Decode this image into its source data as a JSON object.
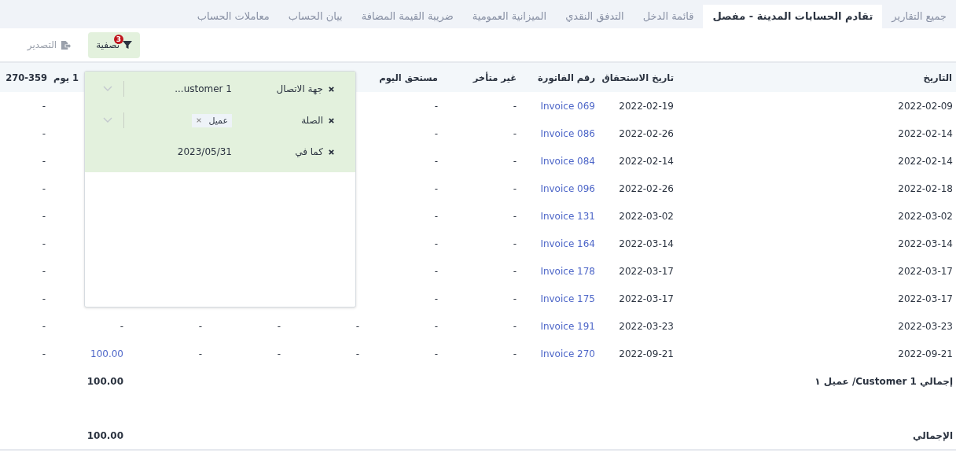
{
  "tabs": [
    {
      "label": "جميع التقارير",
      "selected": false
    },
    {
      "label": "تقادم الحسابات المدينة - مفصل",
      "selected": true
    },
    {
      "label": "قائمة الدخل",
      "selected": false
    },
    {
      "label": "التدفق النقدي",
      "selected": false
    },
    {
      "label": "الميزانية العمومية",
      "selected": false
    },
    {
      "label": "ضريبة القيمة المضافة",
      "selected": false
    },
    {
      "label": "بيان الحساب",
      "selected": false
    },
    {
      "label": "معاملات الحساب",
      "selected": false
    }
  ],
  "toolbar": {
    "filter_button": {
      "label": "تصفية",
      "badge": "3"
    },
    "export_button": {
      "label": "التصدير",
      "disabled": true
    }
  },
  "filter_panel": {
    "filters": [
      {
        "kind": "select",
        "label": "جهة الاتصال",
        "value": "...ustomer 1"
      },
      {
        "kind": "tags",
        "label": "الصلة",
        "tags": [
          "عميل"
        ]
      },
      {
        "kind": "date",
        "label": "كما في",
        "value": "2023/05/31"
      }
    ]
  },
  "table": {
    "columns": [
      "التاريخ",
      "تاريخ الاستحقاق",
      "رقم الفاتورة",
      "غير متأخر",
      "مستحق اليوم",
      null,
      null,
      null,
      "1 يوم",
      "270-359"
    ],
    "rows": [
      {
        "cells": [
          "2022-02-09",
          "2022-02-19",
          {
            "text": "Invoice 069",
            "link": true
          },
          "-",
          "-",
          null,
          null,
          null,
          null,
          "-"
        ]
      },
      {
        "cells": [
          "2022-02-14",
          "2022-02-26",
          {
            "text": "Invoice 086",
            "link": true
          },
          "-",
          "-",
          null,
          null,
          null,
          null,
          "-"
        ]
      },
      {
        "cells": [
          "2022-02-14",
          "2022-02-14",
          {
            "text": "Invoice 084",
            "link": true
          },
          "-",
          "-",
          null,
          null,
          null,
          null,
          "-"
        ]
      },
      {
        "cells": [
          "2022-02-18",
          "2022-02-26",
          {
            "text": "Invoice 096",
            "link": true
          },
          "-",
          "-",
          null,
          null,
          null,
          null,
          "-"
        ]
      },
      {
        "cells": [
          "2022-03-02",
          "2022-03-02",
          {
            "text": "Invoice 131",
            "link": true
          },
          "-",
          "-",
          null,
          null,
          null,
          null,
          "-"
        ]
      },
      {
        "cells": [
          "2022-03-14",
          "2022-03-14",
          {
            "text": "Invoice 164",
            "link": true
          },
          "-",
          "-",
          null,
          null,
          null,
          null,
          "-"
        ]
      },
      {
        "cells": [
          "2022-03-17",
          "2022-03-17",
          {
            "text": "Invoice 178",
            "link": true
          },
          "-",
          "-",
          null,
          null,
          null,
          null,
          "-"
        ]
      },
      {
        "cells": [
          "2022-03-17",
          "2022-03-17",
          {
            "text": "Invoice 175",
            "link": true
          },
          "-",
          "-",
          null,
          null,
          null,
          null,
          "-"
        ]
      },
      {
        "cells": [
          "2022-03-23",
          "2022-03-23",
          {
            "text": "Invoice 191",
            "link": true
          },
          "-",
          "-",
          "-",
          "-",
          "-",
          "-",
          "-"
        ]
      },
      {
        "cells": [
          "2022-09-21",
          "2022-09-21",
          {
            "text": "Invoice 270",
            "link": true
          },
          "-",
          "-",
          "-",
          "-",
          "-",
          {
            "text": "100.00",
            "link": true
          },
          "-"
        ]
      }
    ],
    "subtotal": {
      "label": "إجمالي 1 Customer/ عميل ١",
      "value": "100.00"
    },
    "total": {
      "label": "الإجمالي",
      "value": "100.00"
    }
  }
}
